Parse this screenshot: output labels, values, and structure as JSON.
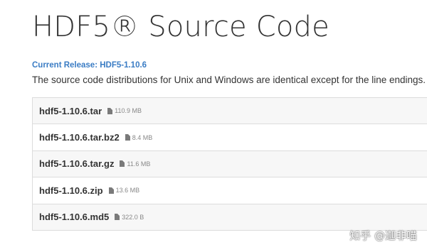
{
  "title": "HDF5® Source Code",
  "release_label": "Current Release: HDF5-1.10.6",
  "description": "The source code distributions for Unix and Windows are identical except for the line endings.",
  "files": [
    {
      "name": "hdf5-1.10.6.tar",
      "size": "110.9 MB"
    },
    {
      "name": "hdf5-1.10.6.tar.bz2",
      "size": "8.4 MB"
    },
    {
      "name": "hdf5-1.10.6.tar.gz",
      "size": "11.6 MB"
    },
    {
      "name": "hdf5-1.10.6.zip",
      "size": "13.6 MB"
    },
    {
      "name": "hdf5-1.10.6.md5",
      "size": "322.0 B"
    }
  ],
  "watermark": "知乎 @迦非喵",
  "colors": {
    "accent": "#3a7cc4",
    "text": "#333333",
    "row_alt": "#f7f7f7",
    "border": "#dcdcdc"
  },
  "icons": {
    "file": "file-icon"
  }
}
